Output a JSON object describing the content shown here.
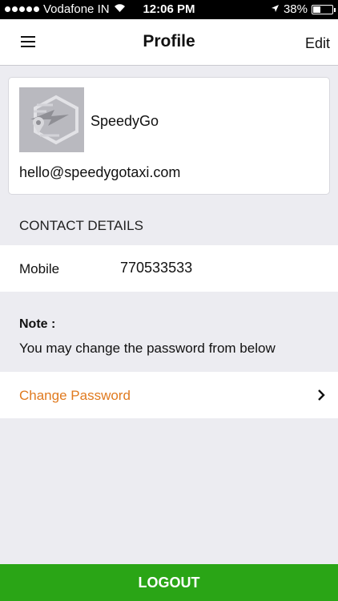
{
  "status_bar": {
    "carrier": "Vodafone IN",
    "time": "12:06 PM",
    "battery": "38%",
    "battery_level": 0.38,
    "icons": [
      "signal-dots-icon",
      "wifi-icon",
      "location-arrow-icon",
      "battery-icon"
    ]
  },
  "nav": {
    "title": "Profile",
    "edit_label": "Edit",
    "menu_icon": "hamburger-menu-icon"
  },
  "profile": {
    "company_name": "SpeedyGo",
    "email": "hello@speedygotaxi.com",
    "avatar_icon": "speedygo-logo"
  },
  "contact": {
    "section_title": "CONTACT DETAILS",
    "mobile_label": "Mobile",
    "mobile_value": "770533533"
  },
  "note": {
    "title": "Note :",
    "text": "You may change the password from below"
  },
  "change_password": {
    "label": "Change Password",
    "chevron_icon": "chevron-right-icon"
  },
  "logout_label": "LOGOUT",
  "colors": {
    "accent_orange": "#e07a1f",
    "logout_green": "#2aa516",
    "background": "#ececf1"
  }
}
